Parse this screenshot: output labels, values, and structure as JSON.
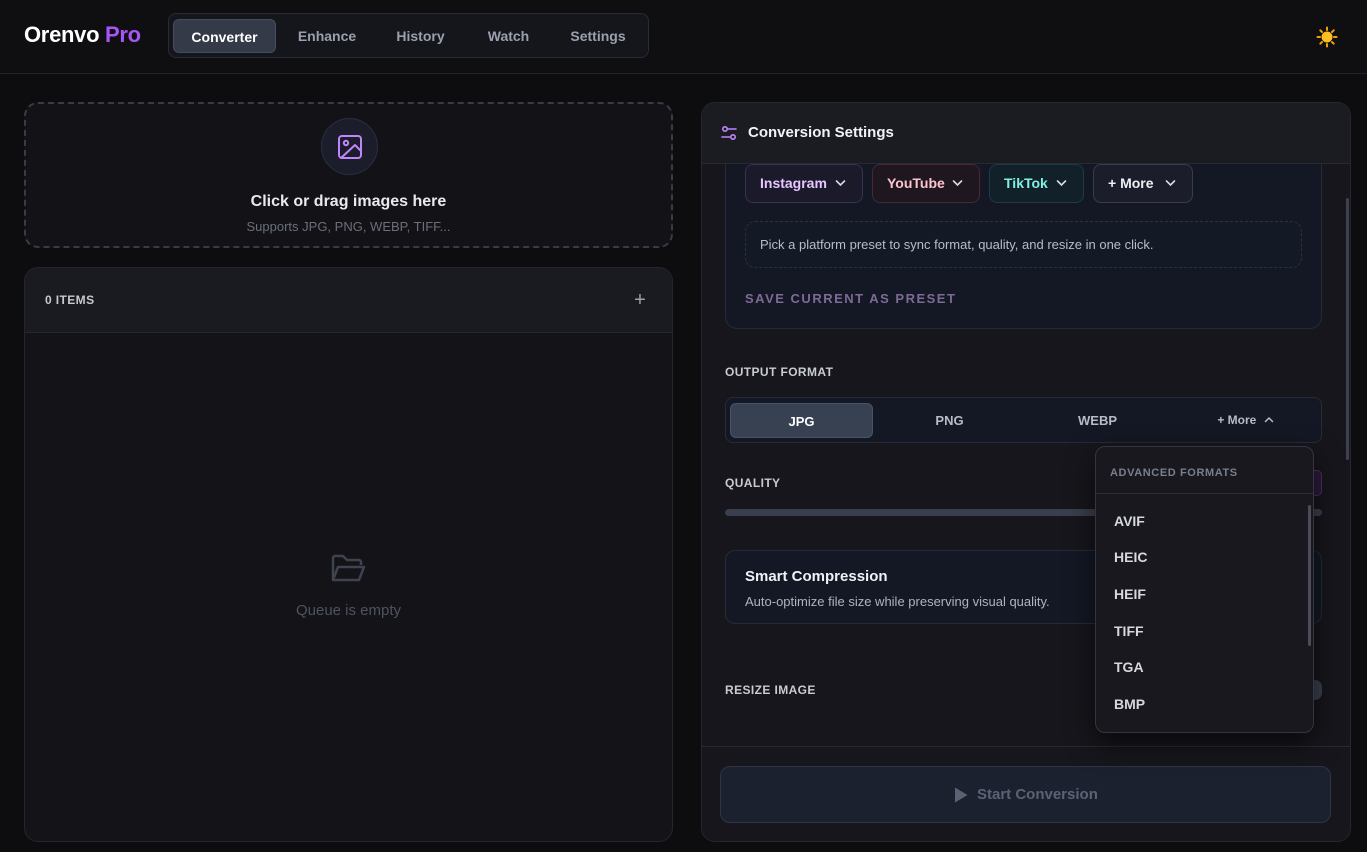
{
  "header": {
    "brand_main": "Orenvo",
    "brand_accent": "Pro",
    "tabs": [
      {
        "label": "Converter",
        "active": true
      },
      {
        "label": "Enhance"
      },
      {
        "label": "History"
      },
      {
        "label": "Watch"
      },
      {
        "label": "Settings"
      }
    ],
    "theme_icon": "sun-icon"
  },
  "dropzone": {
    "icon": "image-icon",
    "title": "Click or drag images here",
    "subtitle": "Supports JPG, PNG, WEBP, TIFF..."
  },
  "queue": {
    "count_label": "0 ITEMS",
    "add_icon": "+",
    "empty_icon": "folder-open-icon",
    "empty_text": "Queue is empty"
  },
  "settings": {
    "title": "Conversion Settings",
    "title_icon": "sliders-icon",
    "presets": [
      {
        "label": "Instagram",
        "color": "#e8c6ff"
      },
      {
        "label": "YouTube",
        "color": "#ffc3cc"
      },
      {
        "label": "TikTok",
        "color": "#7ff0e1"
      },
      {
        "label": "+ More",
        "color": "#eef0f5"
      }
    ],
    "preset_hint": "Pick a platform preset to sync format, quality, and resize in one click.",
    "save_preset_label": "SAVE CURRENT AS PRESET",
    "output_format_label": "OUTPUT FORMAT",
    "formats": [
      {
        "label": "JPG",
        "active": true
      },
      {
        "label": "PNG"
      },
      {
        "label": "WEBP"
      },
      {
        "label": "+ More"
      }
    ],
    "quality_label": "QUALITY",
    "smart_compression": {
      "title": "Smart Compression",
      "description": "Auto-optimize file size while preserving visual quality."
    },
    "resize_label": "RESIZE IMAGE",
    "start_button": "Start Conversion"
  },
  "advanced_formats": {
    "header": "ADVANCED FORMATS",
    "items": [
      "AVIF",
      "HEIC",
      "HEIF",
      "TIFF",
      "TGA",
      "BMP"
    ]
  },
  "colors": {
    "accent": "#a855f7",
    "background": "#0d0d10"
  }
}
